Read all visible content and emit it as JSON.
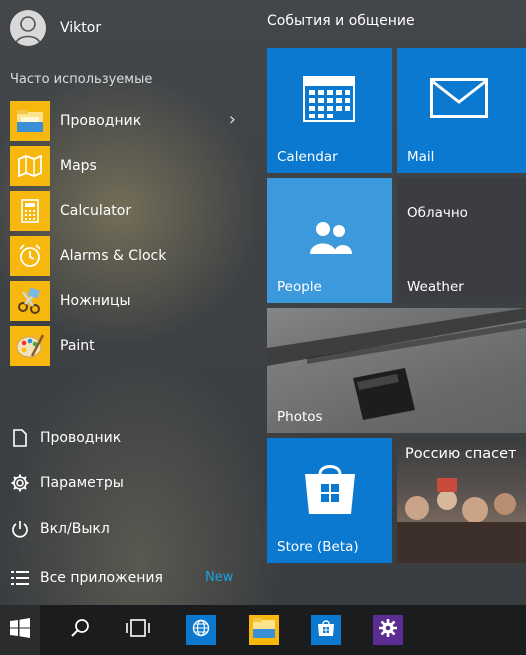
{
  "user": {
    "name": "Viktor"
  },
  "frequent": {
    "title": "Часто используемые",
    "apps": [
      {
        "label": "Проводник",
        "icon": "folder-icon",
        "has_submenu": true
      },
      {
        "label": "Maps",
        "icon": "map-icon"
      },
      {
        "label": "Calculator",
        "icon": "calculator-icon"
      },
      {
        "label": "Alarms & Clock",
        "icon": "alarm-clock-icon"
      },
      {
        "label": "Ножницы",
        "icon": "scissors-icon"
      },
      {
        "label": "Paint",
        "icon": "paint-palette-icon"
      }
    ]
  },
  "system": {
    "explorer": "Проводник",
    "settings": "Параметры",
    "power": "Вкл/Выкл",
    "all_apps": "Все приложения",
    "new_badge": "New"
  },
  "tiles": {
    "group_title": "События и общение",
    "calendar": "Calendar",
    "mail": "Mail",
    "people": "People",
    "weather": {
      "label": "Weather",
      "condition": "Облачно"
    },
    "photos": "Photos",
    "store": "Store (Beta)",
    "news": "Россию спасет"
  },
  "colors": {
    "accent": "#0a79cf",
    "people_tile": "#3c99dc",
    "app_icon_bg": "#f6b70e",
    "new_badge": "#1ba1e2"
  }
}
